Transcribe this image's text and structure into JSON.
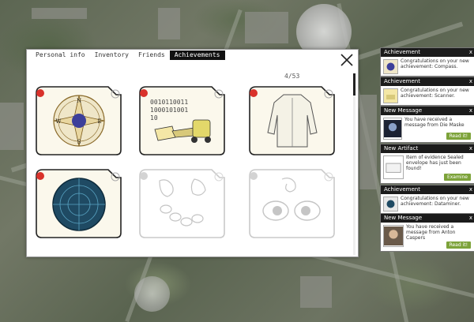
{
  "tabs": [
    {
      "label": "Personal info"
    },
    {
      "label": "Inventory"
    },
    {
      "label": "Friends"
    },
    {
      "label": "Achievements"
    }
  ],
  "counter": "4/53",
  "achievements": [
    {
      "name": "Compass",
      "icon": "compass-icon",
      "locked": false
    },
    {
      "name": "Scanner",
      "icon": "scanner-icon",
      "locked": false
    },
    {
      "name": "Coat",
      "icon": "coat-icon",
      "locked": false
    },
    {
      "name": "Dataminer",
      "icon": "dataminer-icon",
      "locked": false
    },
    {
      "name": "Locked sketch",
      "icon": "hands-chain-icon",
      "locked": true
    },
    {
      "name": "Locked sketch",
      "icon": "eyes-icon",
      "locked": true
    }
  ],
  "card_code_text": "0010110011\n1000101001\n10",
  "notifications": [
    {
      "title": "Achievement",
      "text": "Congratulations on your new achievement: Compass.",
      "button": ""
    },
    {
      "title": "Achievement",
      "text": "Congratulations on your new achievement: Scanner.",
      "button": ""
    },
    {
      "title": "New Message",
      "text": "You have received a message from Die Maske",
      "button": "Read it!"
    },
    {
      "title": "New Artifact",
      "text": "Item of evidence Sealed envelope has just been found!",
      "button": "Examine"
    },
    {
      "title": "Achievement",
      "text": "Congratulations on your new achievement: Dataminer.",
      "button": ""
    },
    {
      "title": "New Message",
      "text": "You have received a message from Anton Caspers",
      "button": "Read it!"
    }
  ],
  "close_symbol": "x",
  "colors": {
    "accent_red": "#d9322b",
    "button_green": "#7da33a",
    "header_dark": "#1b1b1b"
  }
}
